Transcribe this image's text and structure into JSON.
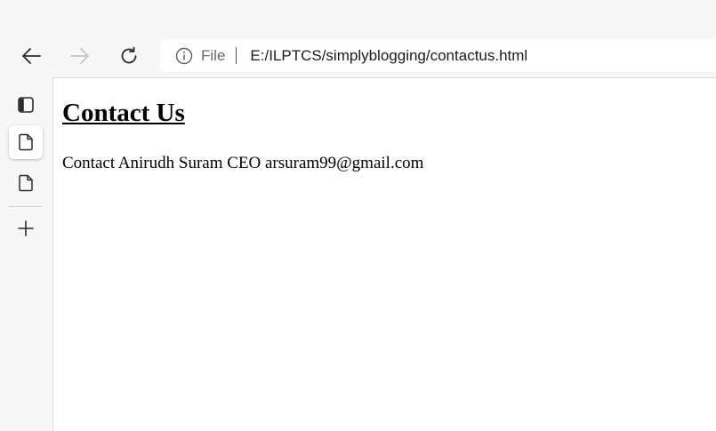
{
  "address_bar": {
    "protocol_label": "File",
    "url": "E:/ILPTCS/simplyblogging/contactus.html"
  },
  "navigation": {
    "back_icon": "arrow-left-icon",
    "forward_icon": "arrow-right-icon",
    "refresh_icon": "refresh-icon",
    "forward_disabled": true
  },
  "sidebar": {
    "items": [
      {
        "icon": "tab-actions-icon"
      },
      {
        "icon": "page-icon",
        "active": true
      },
      {
        "icon": "page-icon",
        "active": false
      },
      {
        "icon": "plus-icon"
      }
    ]
  },
  "page": {
    "heading": "Contact Us",
    "text": "Contact Anirudh Suram CEO arsuram99@gmail.com"
  },
  "colors": {
    "chrome_background": "#f7f7f7",
    "page_background": "#ffffff",
    "disabled_icon": "#c4c4c4"
  }
}
